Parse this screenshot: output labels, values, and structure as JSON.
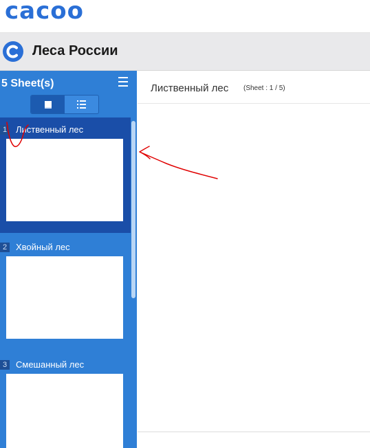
{
  "app": {
    "logo_text": "cacoo"
  },
  "document": {
    "title": "Леса России"
  },
  "sidebar": {
    "sheet_count_label": "5 Sheet(s)",
    "view_toggle": {
      "active": "thumbnail"
    },
    "sheets": [
      {
        "number": "1",
        "name": "Лиственный лес",
        "selected": true
      },
      {
        "number": "2",
        "name": "Хвойный лес",
        "selected": false
      },
      {
        "number": "3",
        "name": "Смешанный лес",
        "selected": false
      }
    ]
  },
  "main": {
    "sheet_title": "Лиственный лес",
    "sheet_position": "(Sheet : 1 / 5)"
  },
  "colors": {
    "accent": "#2a6fd6",
    "sidebar": "#2f7fd6",
    "selected": "#1a4ea8",
    "annotation": "#e00000"
  }
}
